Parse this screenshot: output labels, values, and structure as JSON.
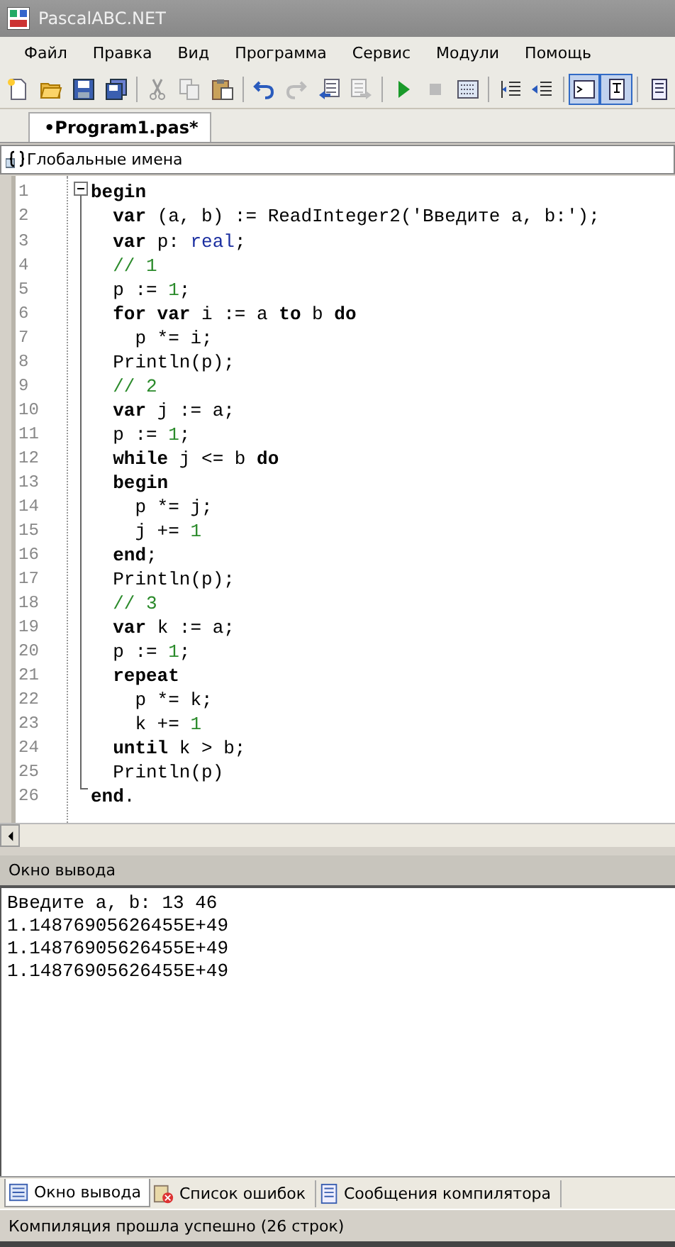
{
  "window": {
    "title": "PascalABC.NET"
  },
  "menu": [
    {
      "label": "Файл"
    },
    {
      "label": "Правка"
    },
    {
      "label": "Вид"
    },
    {
      "label": "Программа"
    },
    {
      "label": "Сервис"
    },
    {
      "label": "Модули"
    },
    {
      "label": "Помощь"
    }
  ],
  "toolbar": [
    {
      "kind": "new",
      "pressed": false
    },
    {
      "kind": "open",
      "pressed": false
    },
    {
      "kind": "save",
      "pressed": false
    },
    {
      "kind": "saveall",
      "pressed": false
    },
    {
      "kind": "separator"
    },
    {
      "kind": "cut",
      "pressed": false
    },
    {
      "kind": "copy",
      "pressed": false
    },
    {
      "kind": "paste",
      "pressed": false
    },
    {
      "kind": "separator"
    },
    {
      "kind": "undo",
      "pressed": false
    },
    {
      "kind": "redo",
      "pressed": false
    },
    {
      "kind": "docleft",
      "pressed": false
    },
    {
      "kind": "docright",
      "pressed": false
    },
    {
      "kind": "separator"
    },
    {
      "kind": "run",
      "pressed": false
    },
    {
      "kind": "stop",
      "pressed": false
    },
    {
      "kind": "grid",
      "pressed": false
    },
    {
      "kind": "separator"
    },
    {
      "kind": "indent",
      "pressed": false
    },
    {
      "kind": "outdent",
      "pressed": false
    },
    {
      "kind": "separator"
    },
    {
      "kind": "console",
      "pressed": true
    },
    {
      "kind": "panel",
      "pressed": true
    },
    {
      "kind": "separator"
    },
    {
      "kind": "page",
      "pressed": false
    }
  ],
  "doc_tabs": [
    {
      "label": "•Program1.pas*",
      "selected": true
    }
  ],
  "scope": {
    "value": "Глобальные имена"
  },
  "editor": {
    "lines": [
      [
        {
          "text": "begin",
          "kind": "kw"
        }
      ],
      [
        {
          "text": "  var",
          "kind": "kw"
        },
        {
          "text": " (a, b) := ReadInteger2('Введите a, b:');",
          "kind": "p"
        }
      ],
      [
        {
          "text": "  var",
          "kind": "kw"
        },
        {
          "text": " p: ",
          "kind": "p"
        },
        {
          "text": "real",
          "kind": "type"
        },
        {
          "text": ";",
          "kind": "p"
        }
      ],
      [
        {
          "text": "  // 1",
          "kind": "comment"
        }
      ],
      [
        {
          "text": "  p := ",
          "kind": "p"
        },
        {
          "text": "1",
          "kind": "num"
        },
        {
          "text": ";",
          "kind": "p"
        }
      ],
      [
        {
          "text": "  for var",
          "kind": "kw"
        },
        {
          "text": " i := a ",
          "kind": "p"
        },
        {
          "text": "to",
          "kind": "kw"
        },
        {
          "text": " b ",
          "kind": "p"
        },
        {
          "text": "do",
          "kind": "kw"
        }
      ],
      [
        {
          "text": "    p *= i;",
          "kind": "p"
        }
      ],
      [
        {
          "text": "  Println(p);",
          "kind": "p"
        }
      ],
      [
        {
          "text": "  // 2",
          "kind": "comment"
        }
      ],
      [
        {
          "text": "  var",
          "kind": "kw"
        },
        {
          "text": " j := a;",
          "kind": "p"
        }
      ],
      [
        {
          "text": "  p := ",
          "kind": "p"
        },
        {
          "text": "1",
          "kind": "num"
        },
        {
          "text": ";",
          "kind": "p"
        }
      ],
      [
        {
          "text": "  while",
          "kind": "kw"
        },
        {
          "text": " j <= b ",
          "kind": "p"
        },
        {
          "text": "do",
          "kind": "kw"
        }
      ],
      [
        {
          "text": "  begin",
          "kind": "kw"
        }
      ],
      [
        {
          "text": "    p *= j;",
          "kind": "p"
        }
      ],
      [
        {
          "text": "    j += ",
          "kind": "p"
        },
        {
          "text": "1",
          "kind": "num"
        }
      ],
      [
        {
          "text": "  end",
          "kind": "kw"
        },
        {
          "text": ";",
          "kind": "p"
        }
      ],
      [
        {
          "text": "  Println(p);",
          "kind": "p"
        }
      ],
      [
        {
          "text": "  // 3",
          "kind": "comment"
        }
      ],
      [
        {
          "text": "  var",
          "kind": "kw"
        },
        {
          "text": " k := a;",
          "kind": "p"
        }
      ],
      [
        {
          "text": "  p := ",
          "kind": "p"
        },
        {
          "text": "1",
          "kind": "num"
        },
        {
          "text": ";",
          "kind": "p"
        }
      ],
      [
        {
          "text": "  repeat",
          "kind": "kw"
        }
      ],
      [
        {
          "text": "    p *= k;",
          "kind": "p"
        }
      ],
      [
        {
          "text": "    k += ",
          "kind": "p"
        },
        {
          "text": "1",
          "kind": "num"
        }
      ],
      [
        {
          "text": "  until",
          "kind": "kw"
        },
        {
          "text": " k > b;",
          "kind": "p"
        }
      ],
      [
        {
          "text": "  Println(p)",
          "kind": "p"
        }
      ],
      [
        {
          "text": "end",
          "kind": "kw"
        },
        {
          "text": ".",
          "kind": "p"
        }
      ]
    ],
    "line_numbers": [
      "1",
      "2",
      "3",
      "4",
      "5",
      "6",
      "7",
      "8",
      "9",
      "10",
      "11",
      "12",
      "13",
      "14",
      "15",
      "16",
      "17",
      "18",
      "19",
      "20",
      "21",
      "22",
      "23",
      "24",
      "25",
      "26"
    ]
  },
  "output": {
    "title": "Окно вывода",
    "lines": [
      "Введите a, b: 13 46",
      "1.14876905626455E+49",
      "1.14876905626455E+49",
      "1.14876905626455E+49"
    ]
  },
  "bottom_tabs": [
    {
      "label": "Окно вывода",
      "kind": "output",
      "selected": true
    },
    {
      "label": "Список ошибок",
      "kind": "errors",
      "selected": false
    },
    {
      "label": "Сообщения компилятора",
      "kind": "messages",
      "selected": false
    }
  ],
  "status_bar": "Компиляция прошла успешно (26 строк)"
}
